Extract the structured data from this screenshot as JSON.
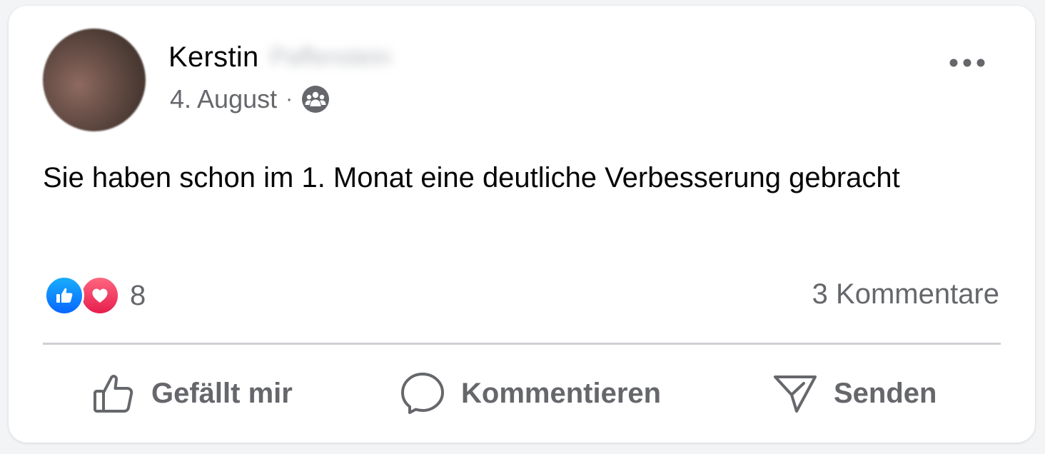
{
  "post": {
    "author_first": "Kerstin",
    "author_last_blurred": "Paffenstein",
    "date": "4. August",
    "separator": "·",
    "audience_icon": "group-icon",
    "text": "Sie haben schon im 1. Monat eine deutliche Verbesserung gebracht"
  },
  "reactions": {
    "icons": [
      "like-icon",
      "love-icon"
    ],
    "count": "8",
    "comments": "3 Kommentare"
  },
  "actions": {
    "like": "Gefällt mir",
    "comment": "Kommentieren",
    "send": "Senden"
  },
  "colors": {
    "secondary_text": "#65676b",
    "like_blue": "#0866ff",
    "love_red": "#e61e4d",
    "divider": "#ced0d4"
  }
}
